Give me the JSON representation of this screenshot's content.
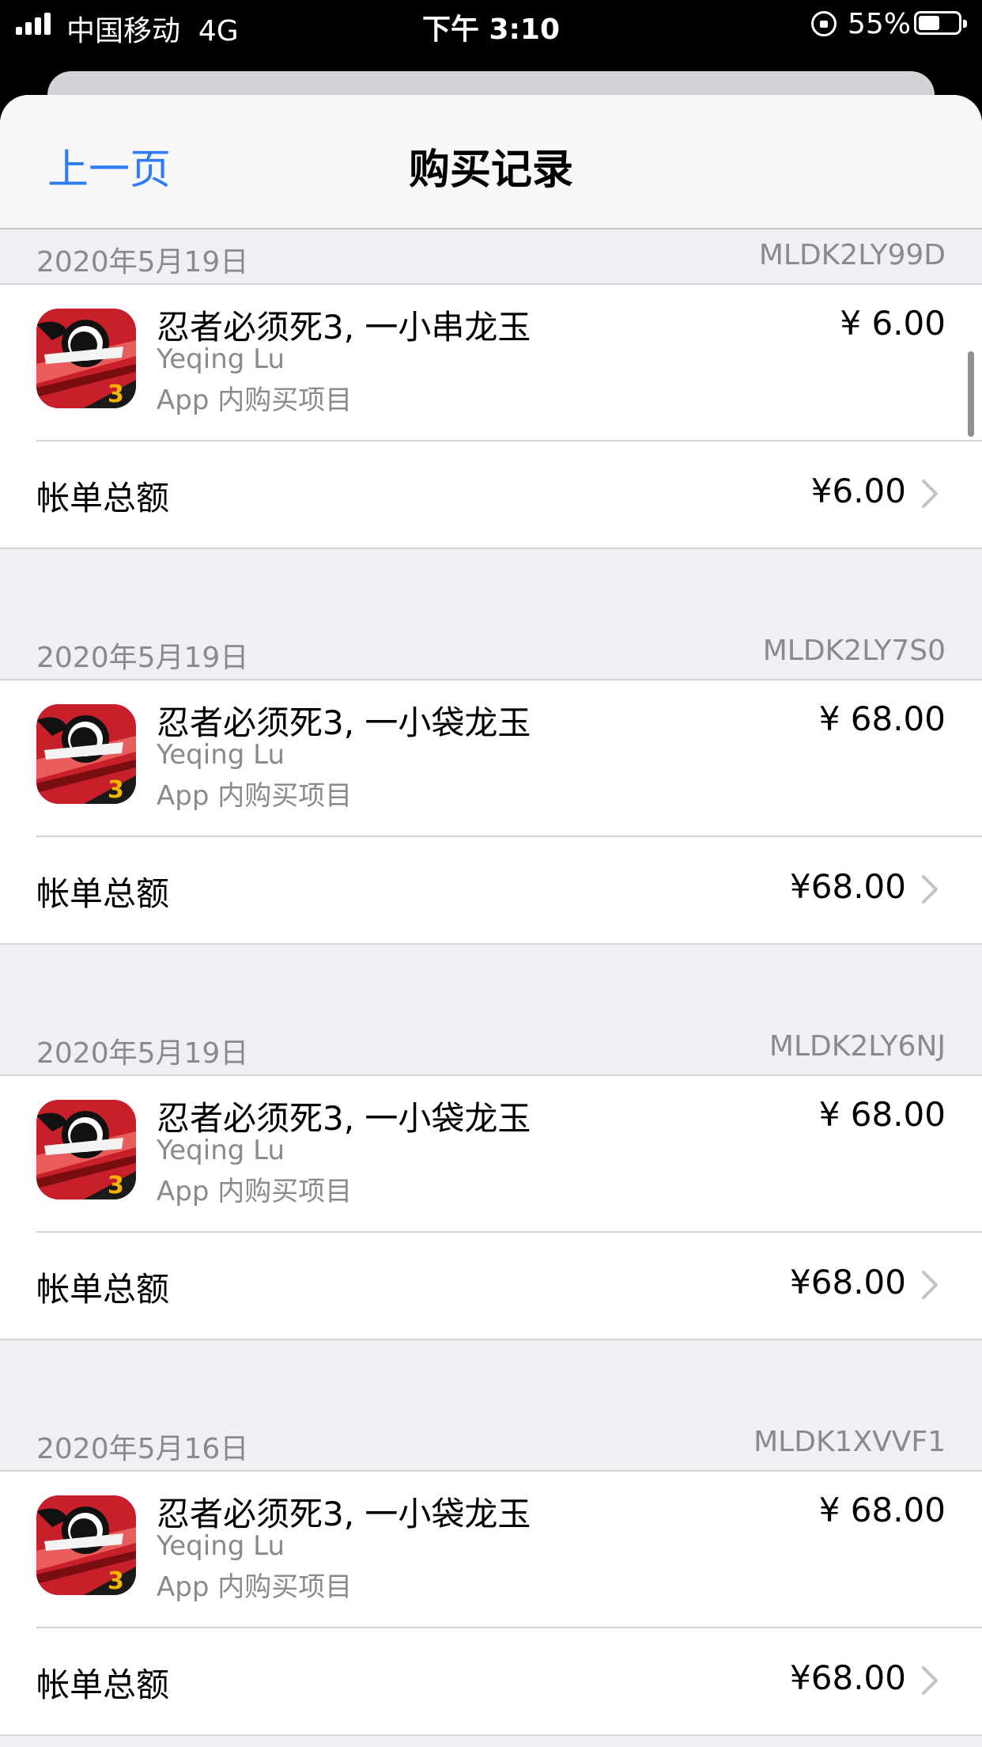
{
  "status_bar": {
    "carrier": "中国移动",
    "network": "4G",
    "time": "下午 3:10",
    "battery": "55%",
    "battery_level": 0.55
  },
  "nav": {
    "back_label": "上一页",
    "title": "购买记录"
  },
  "purchases": [
    {
      "date": "2020年5月19日",
      "order_id": "MLDK2LY99D",
      "item_name": "忍者必须死3, 一小串龙玉",
      "developer": "Yeqing Lu",
      "item_type": "App 内购买项目",
      "price": "¥ 6.00",
      "total_label": "帐单总额",
      "total": "¥6.00"
    },
    {
      "date": "2020年5月19日",
      "order_id": "MLDK2LY7S0",
      "item_name": "忍者必须死3, 一小袋龙玉",
      "developer": "Yeqing Lu",
      "item_type": "App 内购买项目",
      "price": "¥ 68.00",
      "total_label": "帐单总额",
      "total": "¥68.00"
    },
    {
      "date": "2020年5月19日",
      "order_id": "MLDK2LY6NJ",
      "item_name": "忍者必须死3, 一小袋龙玉",
      "developer": "Yeqing Lu",
      "item_type": "App 内购买项目",
      "price": "¥ 68.00",
      "total_label": "帐单总额",
      "total": "¥68.00"
    },
    {
      "date": "2020年5月16日",
      "order_id": "MLDK1XVVF1",
      "item_name": "忍者必须死3, 一小袋龙玉",
      "developer": "Yeqing Lu",
      "item_type": "App 内购买项目",
      "price": "¥ 68.00",
      "total_label": "帐单总额",
      "total": "¥68.00"
    }
  ],
  "colors": {
    "accent": "#2f7cf6",
    "secondary_text": "#8a8a8e",
    "separator": "#d1d1d6",
    "grouped_background": "#efeff4",
    "app_icon_red": "#c8202a"
  },
  "icons": {
    "app_icon": "ninja-game-app-icon",
    "disclosure": "chevron-right-icon"
  }
}
